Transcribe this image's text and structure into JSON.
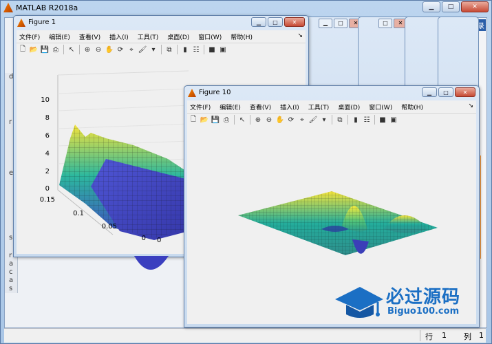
{
  "app": {
    "title": "MATLAB R2018a",
    "right_label": "录"
  },
  "status": {
    "row_label": "行",
    "row_value": "1",
    "col_label": "列",
    "col_value": "1"
  },
  "left_strip_chars": [
    "d",
    "r",
    "e",
    "s",
    "r",
    "a",
    "c",
    "a",
    "s"
  ],
  "figures": [
    {
      "title": "Figure 1",
      "menus": [
        "文件(F)",
        "编辑(E)",
        "查看(V)",
        "插入(I)",
        "工具(T)",
        "桌面(D)",
        "窗口(W)",
        "帮助(H)"
      ],
      "axes": {
        "z_ticks": [
          "10",
          "8",
          "6",
          "4",
          "2",
          "0"
        ],
        "y_ticks": [
          "0.15",
          "0.1",
          "0.05",
          "0"
        ],
        "x_ticks": [
          "0"
        ]
      }
    },
    {
      "title": "Figure 10",
      "menus": [
        "文件(F)",
        "编辑(E)",
        "查看(V)",
        "插入(I)",
        "工具(T)",
        "桌面(D)",
        "窗口(W)",
        "帮助(H)"
      ]
    }
  ],
  "watermark": {
    "cn": "必过源码",
    "en": "Biguo100.com"
  },
  "colors": {
    "surface_low": "#3b3fb8",
    "surface_mid": "#22b2a4",
    "surface_high": "#f2e33a",
    "accent": "#1b6fc4"
  }
}
